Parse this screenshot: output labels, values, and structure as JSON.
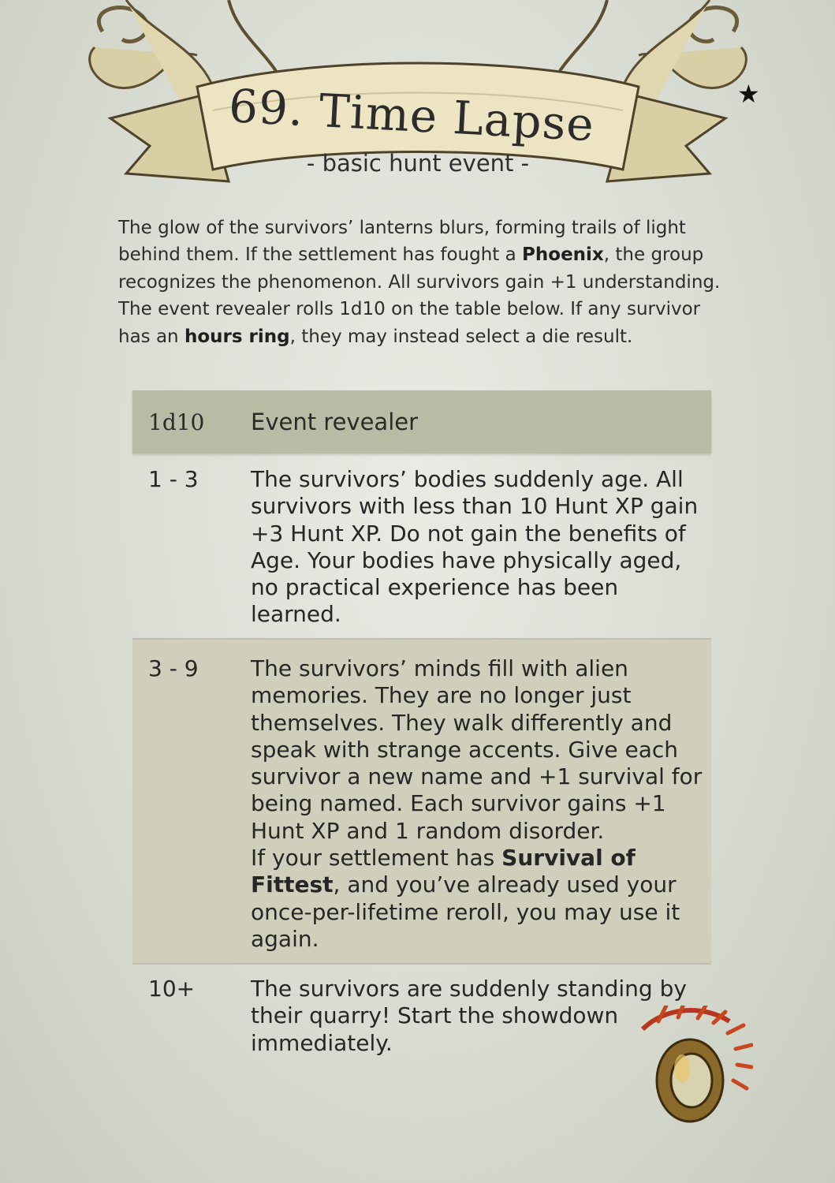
{
  "header": {
    "title": "69. Time Lapse",
    "subtitle": "- basic hunt event -",
    "star": "★"
  },
  "intro": {
    "p1": "The glow of the survivors’ lanterns blurs, forming trails of light behind them. If the settlement has fought a ",
    "b1": "Phoenix",
    "p2": ", the group recognizes the phenomenon. All survivors gain +1 understanding. The event revealer rolls 1d10 on the table below. If any survivor has an ",
    "b2": "hours ring",
    "p3": ", they may instead select a die result."
  },
  "table": {
    "col1": "1d10",
    "col2": "Event revealer",
    "rows": [
      {
        "roll": "1 - 3",
        "text": "The survivors’ bodies suddenly age. All survivors with less than 10 Hunt XP gain +3 Hunt XP. Do not gain the benefits of Age. Your bodies have physically aged, no practical experience has been learned."
      },
      {
        "roll": "3 - 9",
        "text": "The survivors’ minds fill with alien memories. They are no longer just themselves. They walk differently and speak with strange accents. Give each survivor a new name and +1 survival for being named. Each survivor gains +1 Hunt XP and 1 random disorder.",
        "text2": "If your settlement has ",
        "bold": "Survival of Fittest",
        "text3": ", and you’ve already used your once-per-lifetime reroll, you may use it again."
      },
      {
        "roll": "10+",
        "text": "The survivors are suddenly standing by their quarry! Start the showdown immediately."
      }
    ]
  },
  "icons": {
    "banner": "ornate-scroll-banner",
    "ring": "hours-ring-icon"
  }
}
